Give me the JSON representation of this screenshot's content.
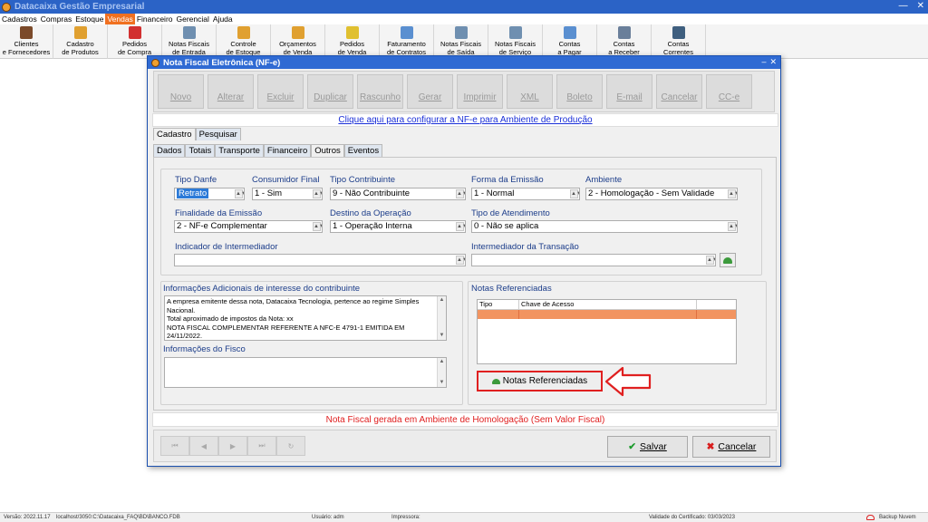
{
  "window": {
    "title": "Datacaixa Gestão Empresarial"
  },
  "menu": [
    "Cadastros",
    "Compras",
    "Estoque",
    "Vendas",
    "Financeiro",
    "Gerencial",
    "Ajuda"
  ],
  "menu_active": "Vendas",
  "toolbar": [
    {
      "label": "Clientes\ne Fornecedores",
      "icon": "users-icon",
      "color": "#7b4a2a"
    },
    {
      "label": "Cadastro\nde Produtos",
      "icon": "boxes-icon",
      "color": "#e0a030"
    },
    {
      "label": "Pedidos\nde Compra",
      "icon": "clipboard-icon",
      "color": "#d23030"
    },
    {
      "label": "Notas Fiscais\nde Entrada",
      "icon": "document-icon",
      "color": "#6f8fb0"
    },
    {
      "label": "Controle\nde Estoque",
      "icon": "stock-icon",
      "color": "#e0a030"
    },
    {
      "label": "Orçamentos\nde Venda",
      "icon": "budget-icon",
      "color": "#e0a030"
    },
    {
      "label": "Pedidos\nde Venda",
      "icon": "order-icon",
      "color": "#e0c030"
    },
    {
      "label": "Faturamento\nde Contratos",
      "icon": "billing-icon",
      "color": "#5a8fd0"
    },
    {
      "label": "Notas Fiscais\nde Saída",
      "icon": "invoice-icon",
      "color": "#6f8fb0"
    },
    {
      "label": "Notas Fiscais\nde Serviço",
      "icon": "service-invoice-icon",
      "color": "#6f8fb0"
    },
    {
      "label": "Contas\na Pagar",
      "icon": "pay-icon",
      "color": "#5a8fd0"
    },
    {
      "label": "Contas\na Receber",
      "icon": "receive-icon",
      "color": "#6a7f9a"
    },
    {
      "label": "Contas\nCorrentes",
      "icon": "accounts-icon",
      "color": "#3f5f7f"
    }
  ],
  "dialog": {
    "title": "Nota Fiscal Eletrônica (NF-e)",
    "actions": [
      "Novo",
      "Alterar",
      "Excluir",
      "Duplicar",
      "Rascunho",
      "Gerar",
      "Imprimir",
      "XML",
      "Boleto",
      "E-mail",
      "Cancelar",
      "CC-e"
    ],
    "config_link": "Clique aqui para configurar a NF-e para Ambiente de Produção",
    "tabs_top": [
      "Cadastro",
      "Pesquisar"
    ],
    "tabs_top_selected": "Cadastro",
    "tabs_sub": [
      "Dados",
      "Totais",
      "Transporte",
      "Financeiro",
      "Outros",
      "Eventos"
    ],
    "tabs_sub_selected": "Outros",
    "fields": {
      "tipo_danfe": {
        "label": "Tipo Danfe",
        "value": "Retrato"
      },
      "consumidor_final": {
        "label": "Consumidor Final",
        "value": "1 - Sim"
      },
      "tipo_contribuinte": {
        "label": "Tipo Contribuinte",
        "value": "9 - Não Contribuinte"
      },
      "forma_emissao": {
        "label": "Forma da Emissão",
        "value": "1 - Normal"
      },
      "ambiente": {
        "label": "Ambiente",
        "value": "2 - Homologação - Sem Validade"
      },
      "finalidade": {
        "label": "Finalidade da Emissão",
        "value": "2 - NF-e Complementar"
      },
      "destino": {
        "label": "Destino da Operação",
        "value": "1 - Operação Interna"
      },
      "tipo_atendimento": {
        "label": "Tipo de Atendimento",
        "value": "0 - Não se aplica"
      },
      "indicador_intermediador": {
        "label": "Indicador de Intermediador",
        "value": ""
      },
      "intermediador_transacao": {
        "label": "Intermediador da Transação",
        "value": ""
      }
    },
    "info_adicionais": {
      "label": "Informações Adicionais de interesse do contribuinte",
      "lines": [
        "A empresa emitente dessa nota, Datacaixa Tecnologia, pertence ao regime Simples",
        "Nacional.",
        "Total aproximado de impostos da Nota:  xx",
        "NOTA FISCAL COMPLEMENTAR REFERENTE A NFC-E 4791-1 EMITIDA EM",
        "24/11/2022."
      ]
    },
    "info_fisco": {
      "label": "Informações do Fisco",
      "value": ""
    },
    "notas_referenciadas": {
      "label": "Notas Referenciadas",
      "columns": [
        "Tipo",
        "Chave de Acesso"
      ],
      "button": "Notas Referenciadas"
    },
    "status_message": "Nota Fiscal gerada em Ambiente de Homologação (Sem Valor Fiscal)",
    "nav_buttons": [
      "⏮",
      "◀",
      "▶",
      "⏭",
      "↻"
    ],
    "save_label": "Salvar",
    "cancel_label": "Cancelar"
  },
  "statusbar": {
    "version": "Versão: 2022.11.17",
    "db": "localhost/3050:C:\\Datacaixa_FAQ\\BD\\BANCO.FDB",
    "user": "Usuário: adm",
    "printer": "Impressora:",
    "cert": "Validade do Certificado: 03/03/2023",
    "backup": "Backup Nuvem"
  },
  "colors": {
    "accent": "#2f6ad3",
    "highlight_row": "#f29460",
    "annotation": "#e02020"
  }
}
